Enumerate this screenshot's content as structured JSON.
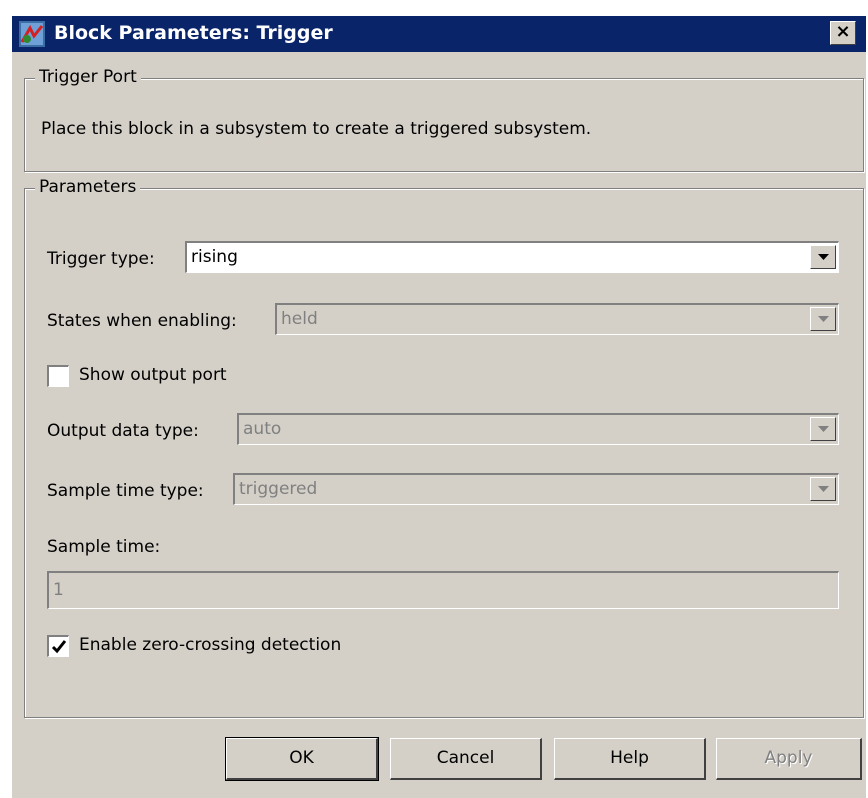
{
  "window": {
    "title": "Block Parameters: Trigger",
    "close_glyph": "×"
  },
  "description_group": {
    "legend": "Trigger Port",
    "text": "Place this block in a subsystem to create a triggered subsystem."
  },
  "parameters": {
    "legend": "Parameters",
    "trigger_type": {
      "label": "Trigger type:",
      "value": "rising",
      "enabled": true
    },
    "states_when_enabling": {
      "label": "States when enabling:",
      "value": "held",
      "enabled": false
    },
    "show_output_port": {
      "label": "Show output port",
      "checked": false
    },
    "output_data_type": {
      "label": "Output data type:",
      "value": "auto",
      "enabled": false
    },
    "sample_time_type": {
      "label": "Sample time type:",
      "value": "triggered",
      "enabled": false
    },
    "sample_time": {
      "label": "Sample time:",
      "value": "1",
      "enabled": false
    },
    "zero_crossing": {
      "label": "Enable zero-crossing detection",
      "checked": true
    }
  },
  "buttons": {
    "ok": "OK",
    "cancel": "Cancel",
    "help": "Help",
    "apply": "Apply"
  },
  "icons": {
    "title_icon": "simulink-block-icon",
    "close_icon": "close-icon",
    "dropdown_icon": "chevron-down-icon",
    "check_icon": "checkmark-icon"
  },
  "colors": {
    "titlebar": "#0a246a",
    "dialog_bg": "#d4d0c8",
    "disabled_text": "#808080"
  }
}
